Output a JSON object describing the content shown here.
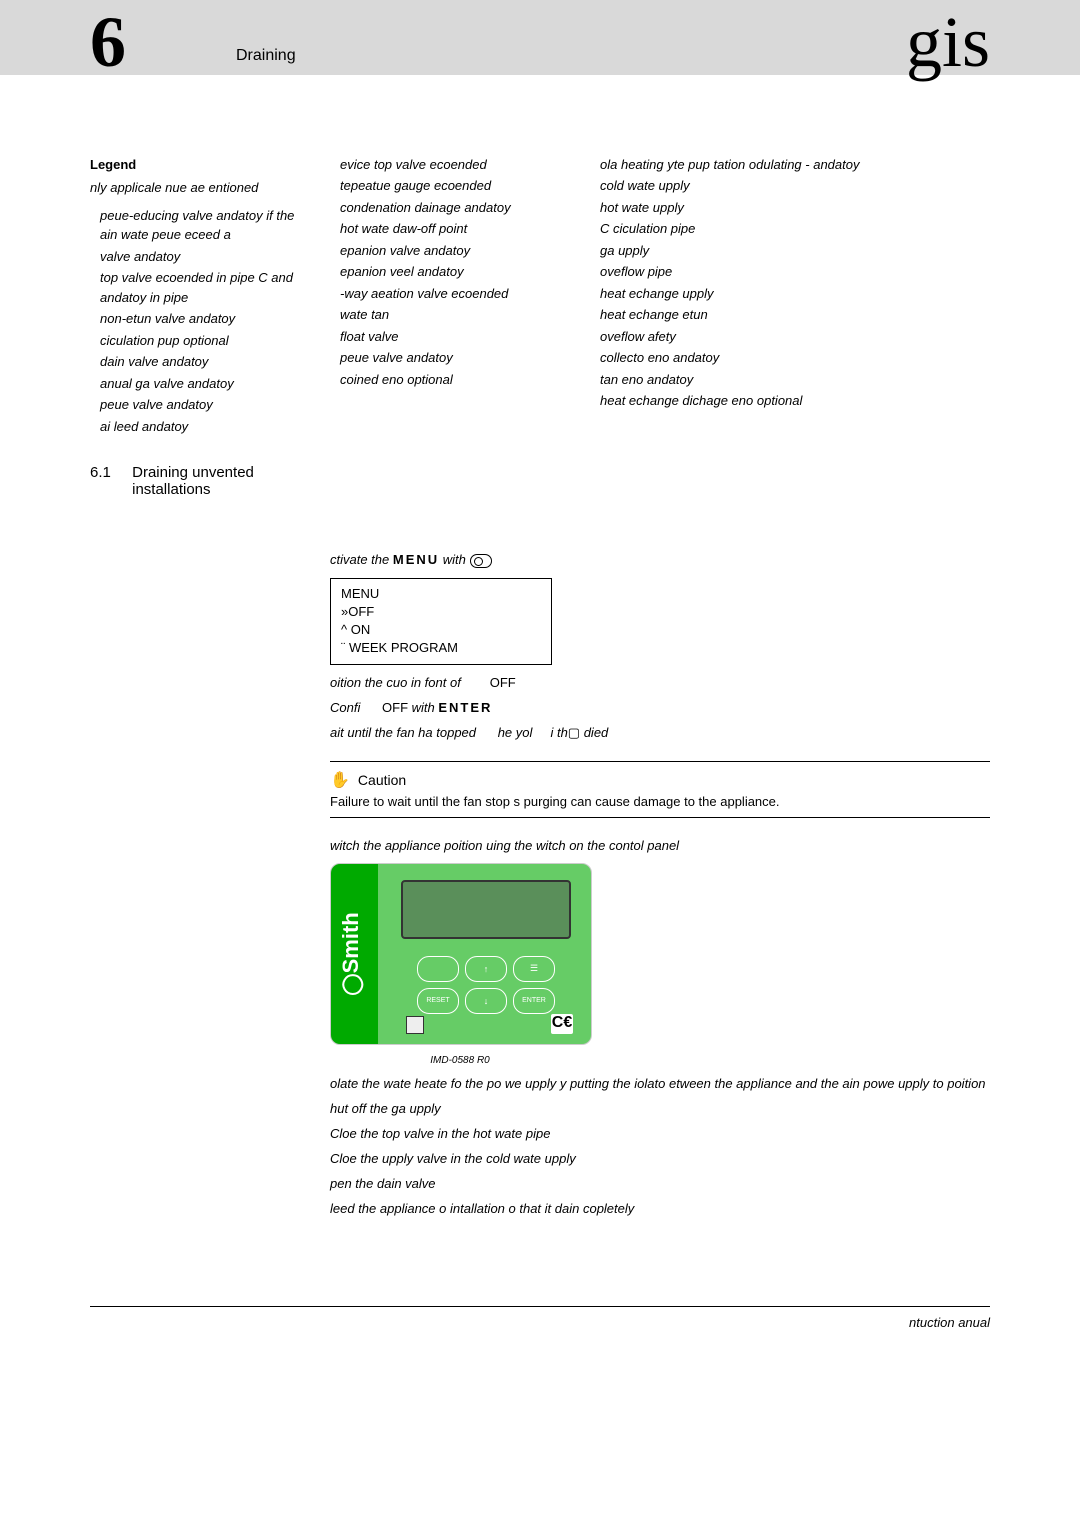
{
  "header": {
    "chapter_num": "6",
    "chapter_title": "Draining",
    "brand": "gis"
  },
  "legend": {
    "title": "Legend",
    "note": "nly applicale nue ae entioned",
    "col1": [
      "peue-educing valve andatoy if the ain wate peue eceed  a",
      "valve andatoy",
      "top valve ecoended in pipe C and andatoy in pipe",
      "non-etun valve andatoy",
      "ciculation pup optional",
      "dain valve andatoy",
      "anual ga valve andatoy",
      "peue valve andatoy",
      "ai leed andatoy"
    ],
    "col2": [
      "evice top valve ecoended",
      "tepeatue gauge ecoended",
      "condenation dainage andatoy",
      "hot wate daw-off point",
      "epanion valve andatoy",
      "epanion veel andatoy",
      "-way aeation valve ecoended",
      "wate tan",
      "float valve",
      "peue valve andatoy",
      "coined  eno optional"
    ],
    "col3": [
      "ola heating yte pup tation odulating - andatoy",
      "cold wate upply",
      "hot wate upply",
      "C  ciculation pipe",
      "ga upply",
      "oveflow pipe",
      "heat echange upply",
      "heat echange etun",
      "oveflow afety",
      "collecto eno andatoy",
      "tan eno andatoy",
      "heat echange dichage eno optional"
    ]
  },
  "section": {
    "num": "6.1",
    "title": "Draining unvented installations"
  },
  "steps": {
    "activate": "ctivate the ",
    "menu_word": "MENU",
    "with_word": "with ",
    "menu_box": {
      "l1": "MENU",
      "l2": "»OFF",
      "l3": "^ ON",
      "l4": "¨ WEEK  PROGRAM"
    },
    "position": "oition the cuo in font of ",
    "off1": "OFF",
    "confirm": "Confi ",
    "off2": "OFF ",
    "with2": "with ",
    "enter": "ENTER",
    "wait": "ait until the fan ha topped ",
    "wait2": "he yol ",
    "wait3": "i th",
    "wait4": " died"
  },
  "caution": {
    "title": "Caution",
    "text": "Failure to wait until the fan stop     s purging can cause damage to the appliance."
  },
  "after": {
    "switch": "witch the appliance        poition  uing the  witch on the contol panel",
    "panel_caption": "IMD-0588 R0",
    "isolate": "olate the wate heate fo the po         we upply y putting the iolato etween the appliance and the ain powe upply to poition",
    "shut": "hut off the ga upply",
    "close1": "Cloe the top valve  in the hot wate pipe",
    "close2": "Cloe the upply valve  in the cold wate upply",
    "open": "pen the dain valve",
    "bleed": "leed the appliance o intallation o that it dain copletely"
  },
  "footer": "ntuction anual",
  "panel": {
    "brand": "Smith",
    "ce": "C€"
  }
}
